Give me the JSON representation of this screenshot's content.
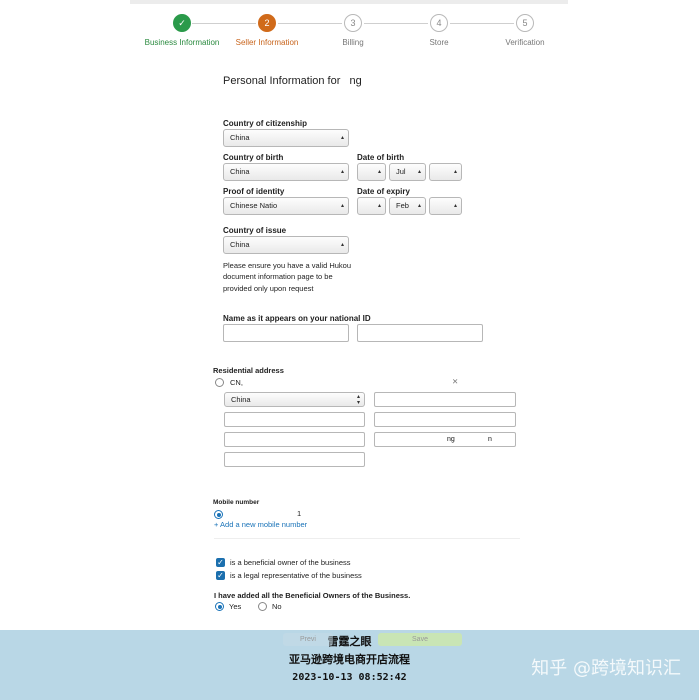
{
  "steps": [
    {
      "number": "✓",
      "label": "Business Information",
      "state": "done"
    },
    {
      "number": "2",
      "label": "Seller Information",
      "state": "active"
    },
    {
      "number": "3",
      "label": "Billing",
      "state": "pending"
    },
    {
      "number": "4",
      "label": "Store",
      "state": "pending"
    },
    {
      "number": "5",
      "label": "Verification",
      "state": "pending"
    }
  ],
  "personal": {
    "heading": "Personal Information for",
    "heading_partial": "ng",
    "citizenship": {
      "label": "Country of citizenship",
      "value": "China"
    },
    "birth_country": {
      "label": "Country of birth",
      "value": "China"
    },
    "dob": {
      "label": "Date of birth",
      "day": "",
      "month": "Jul",
      "year": ""
    },
    "proof": {
      "label": "Proof of identity",
      "value": "Chinese Natio"
    },
    "expiry": {
      "label": "Date of expiry",
      "day": "",
      "month": "Feb",
      "year": ""
    },
    "issue_country": {
      "label": "Country of issue",
      "value": "China"
    },
    "note": "Please ensure you have a valid Hukou document information page to be provided only upon request",
    "name_label": "Name as it appears on your national ID"
  },
  "address": {
    "title": "Residential address",
    "option_label": "CN,",
    "country": "China",
    "line4_partial": "ng",
    "line4_tail": "n"
  },
  "mobile": {
    "title": "Mobile number",
    "number_partial": "1",
    "add_link": "+ Add a new mobile number"
  },
  "owner": {
    "beneficial": "is a beneficial owner of the business",
    "legal": "is a legal representative of the business"
  },
  "all_owners": {
    "question": "I have added all the Beneficial Owners of the Business.",
    "yes": "Yes",
    "no": "No"
  },
  "buttons": {
    "previous": "Previ",
    "save": "Save"
  },
  "banner": {
    "line1": "雷霆之眼",
    "line2": "亚马逊跨境电商开店流程",
    "timestamp": "2023-10-13 08:52:42",
    "watermark": "知乎 @跨境知识汇"
  }
}
